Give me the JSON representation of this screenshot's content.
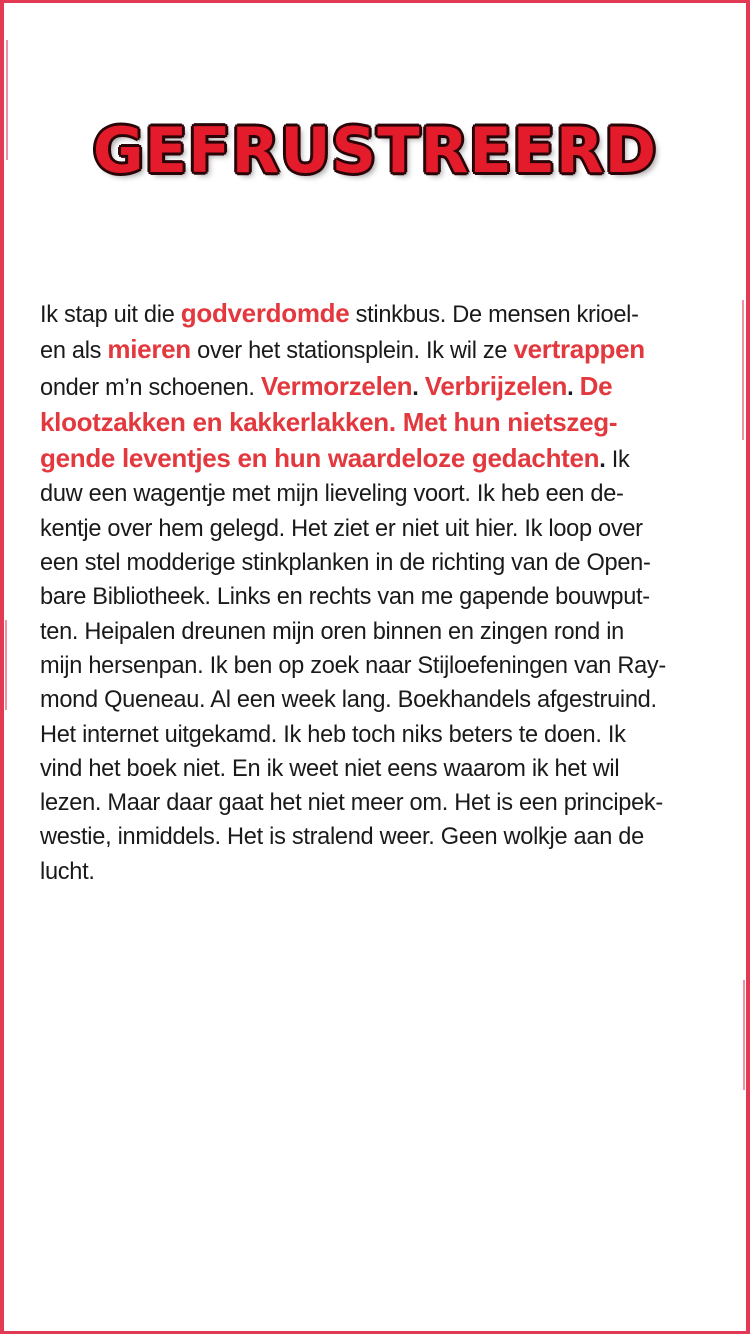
{
  "title": "GEFRUSTREERD",
  "story": {
    "l1": {
      "a": "Ik stap uit die ",
      "hl1": "godverdomde",
      "b": " stinkbus. De mensen krioel-"
    },
    "l2": {
      "a": "en als ",
      "hl1": "mieren",
      "b": " over het stationsplein. Ik wil ze ",
      "hl2": "vertrappen"
    },
    "l3": {
      "a": "onder m’n schoenen. ",
      "hl1": "Vermorzelen",
      "dot1": ".",
      "sp1": " ",
      "hl2": "Verbrijzelen",
      "dot2": ".",
      "sp2": " ",
      "hl3": "De"
    },
    "l4": {
      "hl": "klootzakken en kakkerlakken. Met hun nietszeg-"
    },
    "l5": {
      "hl": "gende leventjes en hun waardeloze gedachten",
      "dot": ".",
      "b": " Ik"
    },
    "l6": "duw een wagentje met mijn lieveling voort. Ik heb een de-",
    "l7": "kentje over hem gelegd. Het ziet er niet uit hier. Ik loop over",
    "l8": "een stel modderige stinkplanken in de richting van de Open-",
    "l9": "bare Bibliotheek. Links en rechts van me gapende bouwput-",
    "l10": "ten. Heipalen dreunen mijn oren binnen en zingen rond in",
    "l11": "mijn hersenpan. Ik ben op zoek naar Stijloefeningen van Ray-",
    "l12": "mond Queneau. Al een week lang. Boekhandels afgestruind.",
    "l13": "Het internet uitgekamd. Ik heb toch niks beters te doen. Ik",
    "l14": "vind het boek niet. En ik weet niet eens waarom ik het wil",
    "l15": "lezen. Maar daar gaat het niet meer om. Het is een principek-",
    "l16": "westie, inmiddels. Het is stralend weer. Geen wolkje aan de",
    "l17": "lucht."
  },
  "colors": {
    "accent": "#e2383e",
    "border": "#e23a55",
    "text": "#1a1a1a",
    "title_outline": "#2a0508"
  }
}
